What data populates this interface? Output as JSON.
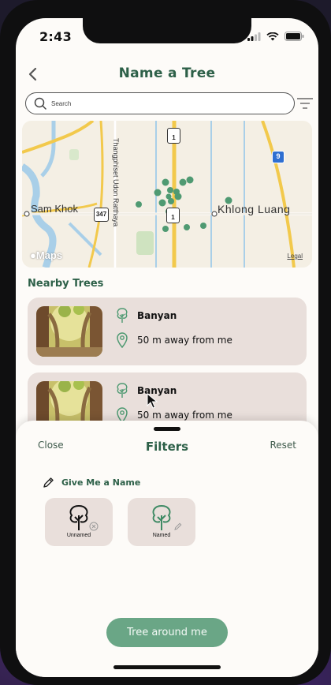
{
  "status_bar": {
    "time": "2:43"
  },
  "header": {
    "title": "Name a Tree"
  },
  "search": {
    "placeholder": "Search"
  },
  "map": {
    "labels": {
      "left_place": "Sam Khok",
      "right_place": "Khlong Luang",
      "road_vertical": "Thangphiset Udon Ratthaya",
      "route_347": "347",
      "route_1_top": "1",
      "route_1_mid": "1",
      "route_9": "9"
    },
    "brand": "Maps",
    "legal": "Legal",
    "tree_pin_color": "#4f9a72"
  },
  "nearby": {
    "title": "Nearby Trees",
    "items": [
      {
        "name": "Banyan",
        "distance": "50 m away from me"
      },
      {
        "name": "Banyan",
        "distance": "50 m away from me"
      }
    ]
  },
  "filters_sheet": {
    "close_label": "Close",
    "title": "Filters",
    "reset_label": "Reset",
    "section_title": "Give Me a Name",
    "chips": [
      {
        "label": "Unnamed",
        "badge_icon": "close-circle-icon"
      },
      {
        "label": "Named",
        "badge_icon": "pencil-icon"
      }
    ],
    "cta_label": "Tree around me"
  },
  "colors": {
    "accent_green": "#2d6048",
    "button_green": "#6aa686",
    "card_bg": "#e9dfdb",
    "map_bg": "#f4efe4"
  }
}
